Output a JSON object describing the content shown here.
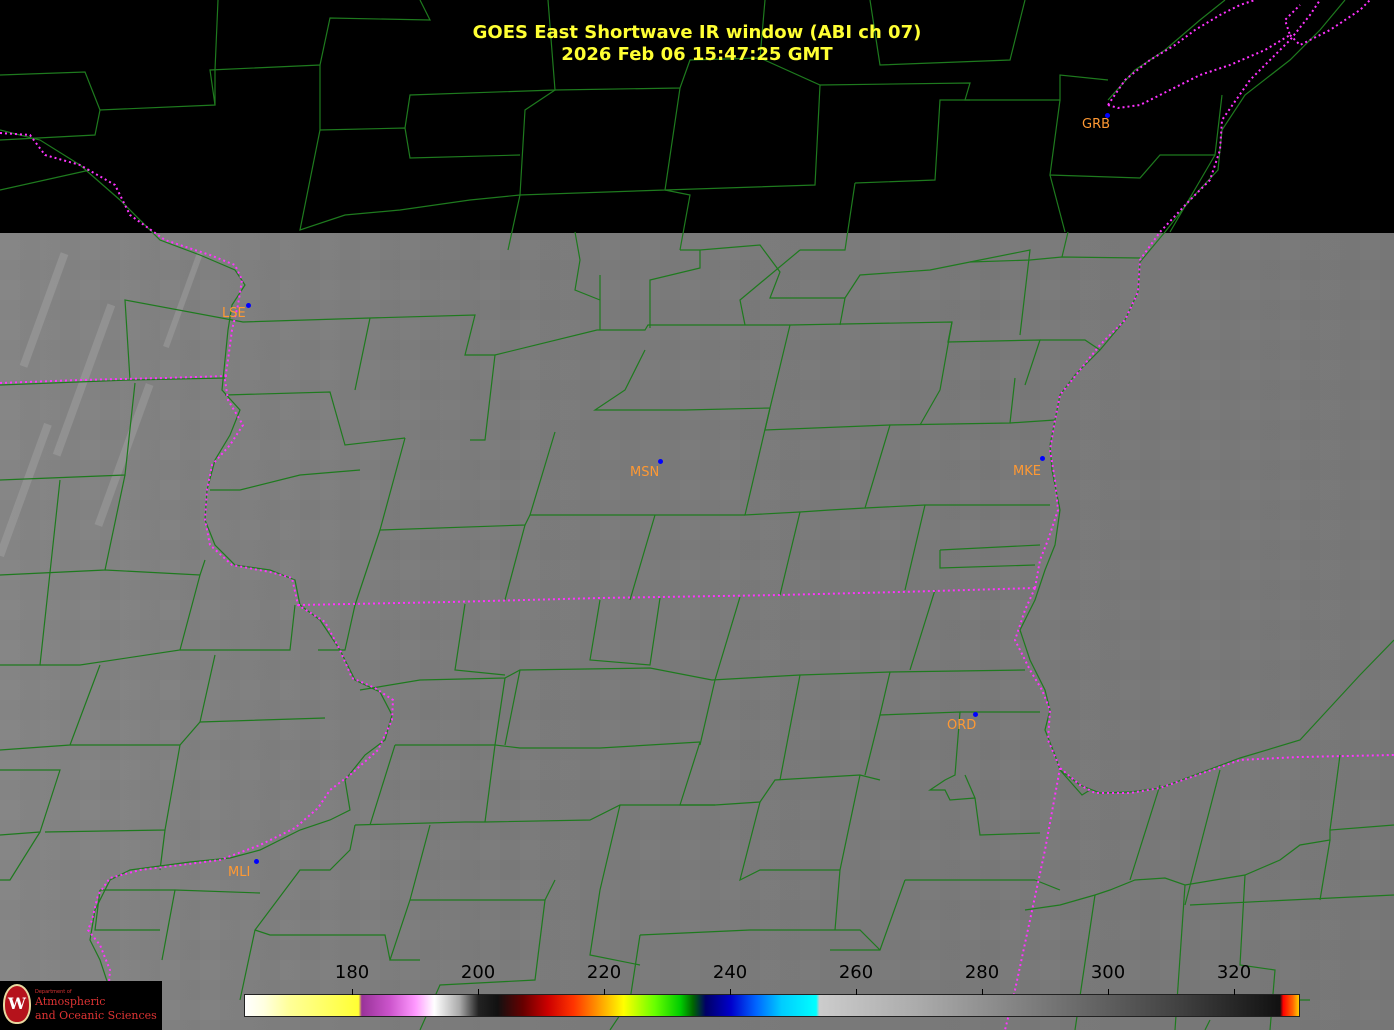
{
  "title": {
    "line1": "GOES East Shortwave IR window (ABI ch 07)",
    "line2": "2026 Feb 06  15:47:25 GMT"
  },
  "colors": {
    "title": "#ffff33",
    "county_lines": "#1e7a1e",
    "state_lines": "#ff33ff",
    "station_label": "#ff9933",
    "station_dot": "#0000ff",
    "imagery_gray": "#7a7a7a"
  },
  "stations": [
    {
      "id": "grb",
      "label": "GRB"
    },
    {
      "id": "lse",
      "label": "LSE"
    },
    {
      "id": "msn",
      "label": "MSN"
    },
    {
      "id": "mke",
      "label": "MKE"
    },
    {
      "id": "ord",
      "label": "ORD"
    },
    {
      "id": "mli",
      "label": "MLI"
    }
  ],
  "colorbar": {
    "unit_note": "",
    "ticks": [
      "180",
      "200",
      "220",
      "240",
      "260",
      "280",
      "300",
      "320"
    ],
    "min": 163,
    "max": 330
  },
  "logo": {
    "seal_letter": "W",
    "dept_small": "Department of",
    "line1": "Atmospheric",
    "line2": "and Oceanic Sciences"
  }
}
